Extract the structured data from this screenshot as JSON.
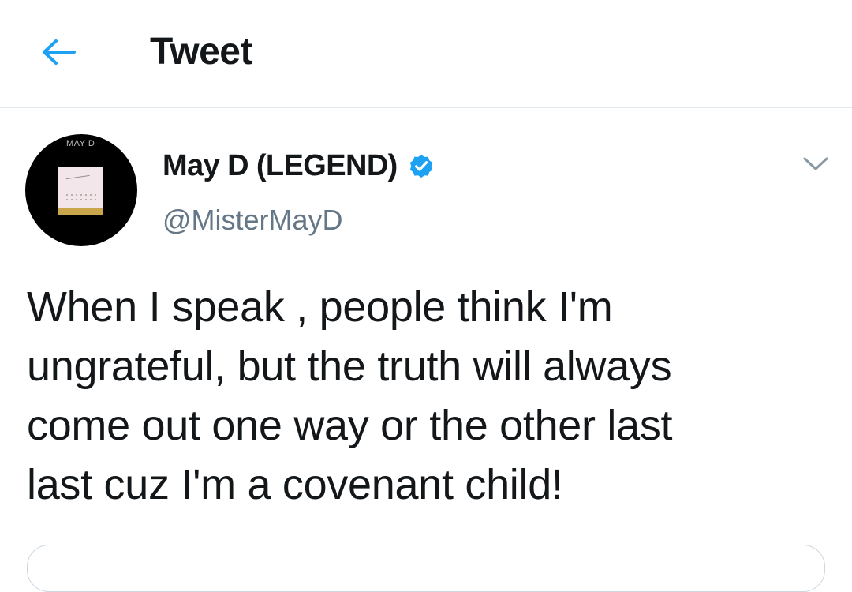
{
  "header": {
    "back_icon": "arrow-left-icon",
    "title": "Tweet"
  },
  "colors": {
    "accent": "#1da1f2",
    "text": "#14171a",
    "muted": "#657786",
    "divider": "#e1e8ed"
  },
  "tweet": {
    "author": {
      "avatar_caption": "MAY D",
      "display_name": "May D (LEGEND)",
      "verified": true,
      "verified_icon": "verified-badge-icon",
      "handle": "@MisterMayD"
    },
    "more_icon": "chevron-down-icon",
    "text": "When I speak , people think I'm\nungrateful,  but the truth will always\ncome out one way or the other last\nlast cuz I'm a covenant child!"
  }
}
